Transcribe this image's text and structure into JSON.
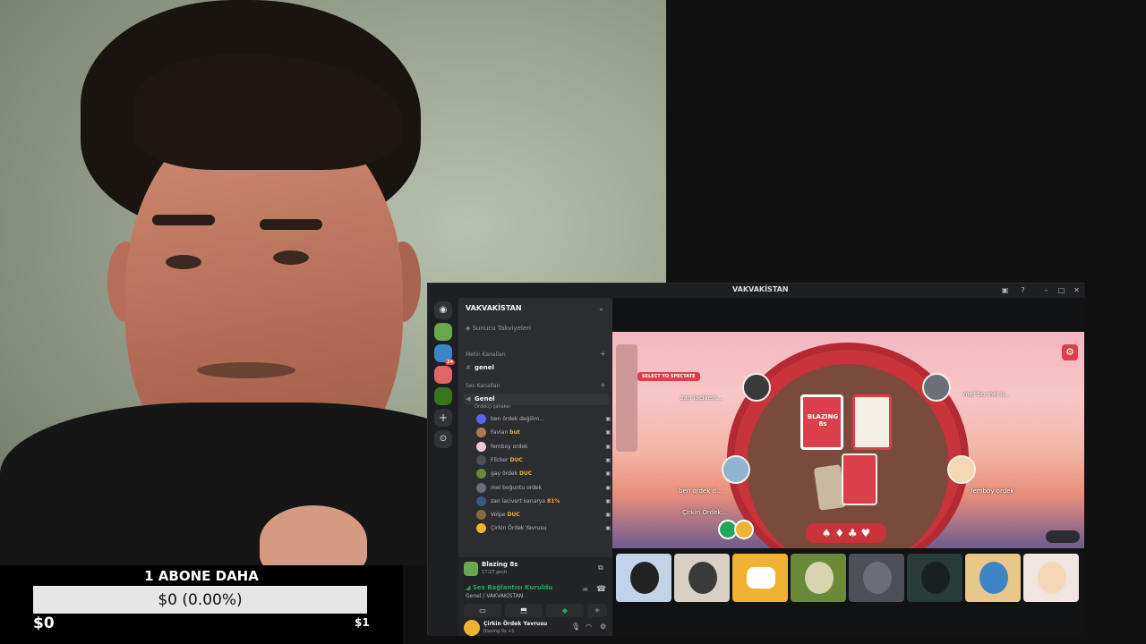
{
  "subgoal": {
    "title": "1 ABONE DAHA",
    "progress_text": "$0 (0.00%)",
    "progress_fraction": 0,
    "min_label": "$0",
    "max_label": "$1"
  },
  "discord": {
    "window_title": "VAKVAKİSTAN",
    "server_name": "VAKVAKİSTAN",
    "boost_label": "Sunucu Takviyeleri",
    "text_category": "Metin Kanalları",
    "text_channel": "genel",
    "voice_category": "Ses Kanalları",
    "voice_channel": "Genel",
    "voice_activity": "Ördekçi şahaker",
    "voice_users": [
      {
        "name": "ben ördek değilim...",
        "tag": "",
        "color": "#5865f2"
      },
      {
        "name": "Favian",
        "tag": "but",
        "color": "#b07a5a"
      },
      {
        "name": "femboy ordek",
        "tag": "",
        "color": "#f0c8d8"
      },
      {
        "name": "Flicker",
        "tag": "DUC",
        "color": "#4e5058"
      },
      {
        "name": "gay ördek",
        "tag": "DUC",
        "color": "#6a8a3a"
      },
      {
        "name": "mel boğuntu ordek",
        "tag": "",
        "color": "#6d6f78"
      },
      {
        "name": "zan lacivert kanarya",
        "tag": "81%",
        "color": "#3a5a7a"
      },
      {
        "name": "Volpe",
        "tag": "DUC",
        "color": "#8a6a3a"
      },
      {
        "name": "Çirkin Ördek Yavrusu",
        "tag": "",
        "color": "#f0b232"
      }
    ],
    "stream_name": "Blazing 8s",
    "stream_time": "17:27 geçti",
    "voice_connected": "Ses Bağlantısı Kuruldu",
    "voice_location": "Genel / VAKVAKİSTAN",
    "user_name": "Çirkin Ördek Yavrusu",
    "user_status": "Blazing 8s +1"
  },
  "game": {
    "spectate_label": "SELECT TO SPECTATE",
    "logo_text": "BLAZING 8s",
    "players": [
      {
        "name": "zan lacivert..."
      },
      {
        "name": "mel bo mel o..."
      },
      {
        "name": "ben ordek d..."
      },
      {
        "name": "femboy ordek"
      },
      {
        "name": "Çirkin Ördek..."
      }
    ],
    "suits": "♠ ♦ ♣ ♥"
  },
  "colors": {
    "accent": "#5865f2",
    "game_red": "#c8333c",
    "online": "#23a55a"
  }
}
